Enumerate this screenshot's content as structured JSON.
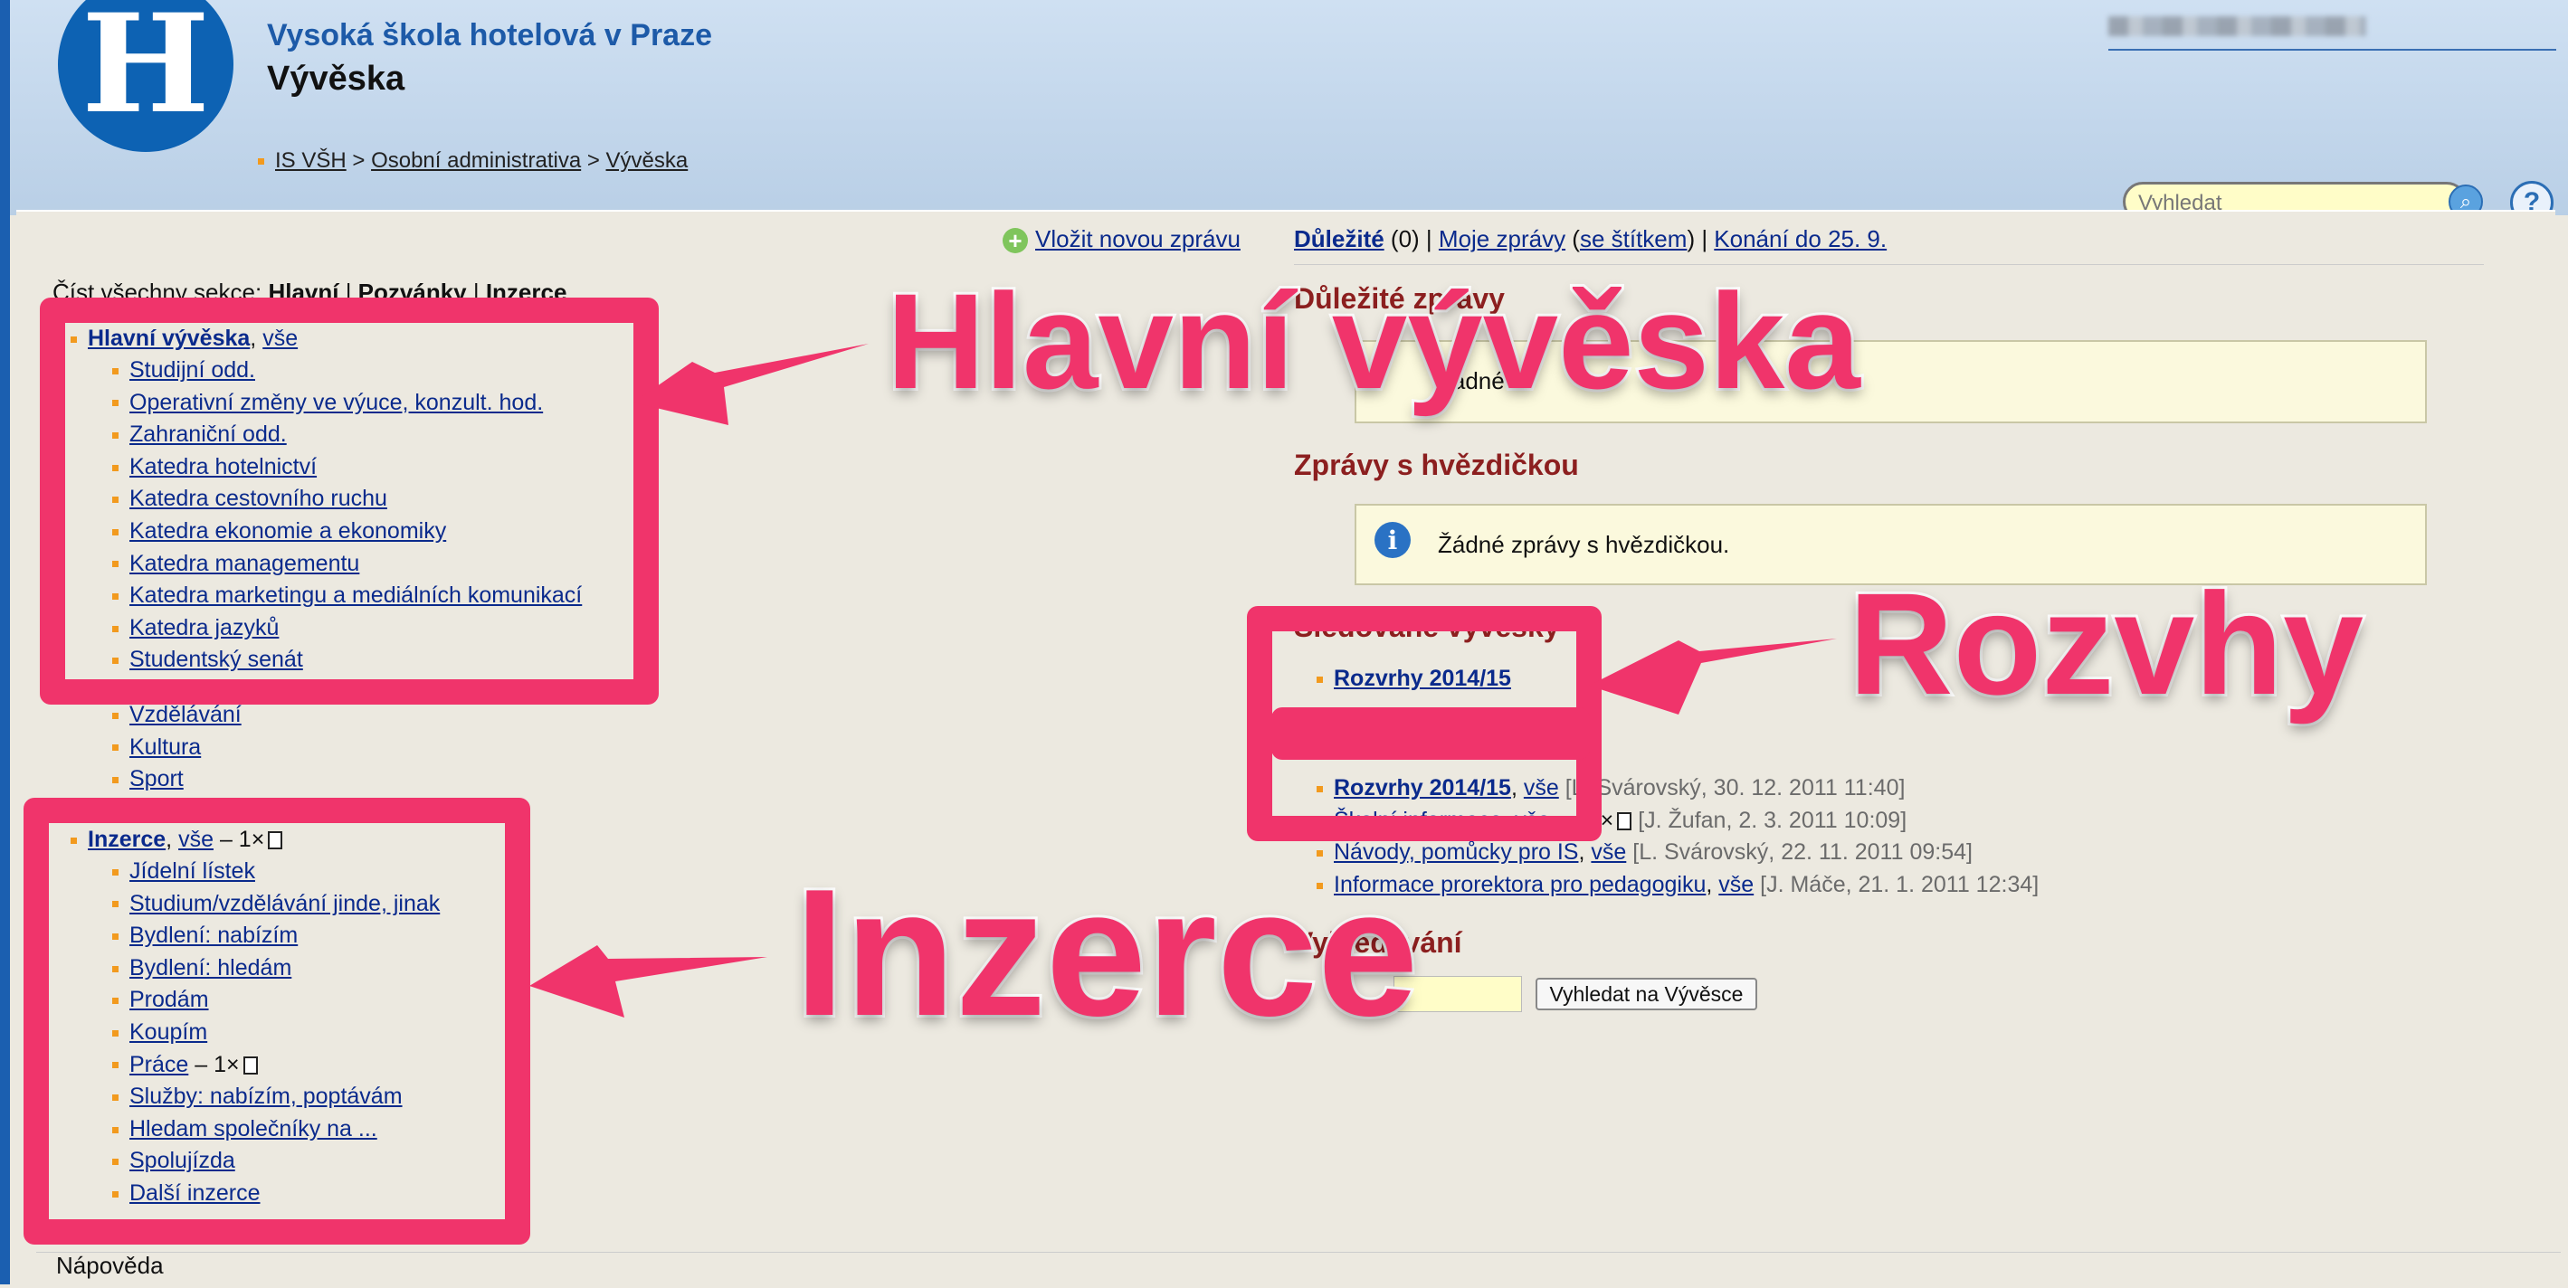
{
  "header": {
    "school": "Vysoká škola hotelová v Praze",
    "title": "Vývěska",
    "logo_letter": "H",
    "breadcrumb": [
      "IS VŠH",
      "Osobní administrativa",
      "Vývěska"
    ],
    "search_placeholder": "Vyhledat",
    "help_label": "?"
  },
  "topbar": {
    "new_message": "Vložit novou zprávu",
    "important": "Důležité",
    "important_count": "(0)",
    "my_messages": "Moje zprávy",
    "with_label": "se štítkem",
    "events": "Konání do 25. 9."
  },
  "left": {
    "read_all_prefix": "Číst všechny sekce:",
    "read_all_links": [
      "Hlavní",
      "Pozvánky",
      "Inzerce"
    ],
    "main_board": {
      "title": "Hlavní vývěska",
      "all": "vše",
      "items": [
        "Studijní odd.",
        "Operativní změny ve výuce, konzult. hod.",
        "Zahraniční odd.",
        "Katedra hotelnictví",
        "Katedra cestovního ruchu",
        "Katedra ekonomie a ekonomiky",
        "Katedra managementu",
        "Katedra marketingu a mediálních komunikací",
        "Katedra jazyků",
        "Studentský senát"
      ]
    },
    "invitations": {
      "items": [
        "Vzdělávání",
        "Kultura",
        "Sport"
      ]
    },
    "ads": {
      "title": "Inzerce",
      "all": "vše",
      "count": "– 1×",
      "items": [
        "Jídelní lístek",
        "Studium/vzdělávání jinde, jinak",
        "Bydlení: nabízím",
        "Bydlení: hledám",
        "Prodám",
        "Koupím",
        "Práce",
        "Služby: nabízím, poptávám",
        "Hledam společníky na ...",
        "Spolujízda",
        "Další inzerce"
      ],
      "prace_count": "– 1×"
    }
  },
  "right": {
    "important_title": "Důležité zprávy",
    "important_box": "Žádné",
    "starred_title": "Zprávy s hvězdičkou",
    "starred_box": "Žádné zprávy s hvězdičkou.",
    "watched_title": "Sledované vývěsky",
    "watched_item": "Rozvrhy 2014/15",
    "recent": [
      {
        "title": "Rozvrhy 2014/15",
        "all": "vše",
        "meta": "[L. Svárovský, 30. 12. 2011 11:40]"
      },
      {
        "title": "Školní informace",
        "all": "vše",
        "count": "– 13×",
        "meta": "[J. Žufan, 2. 3. 2011 10:09]"
      },
      {
        "title": "Návody, pomůcky pro IS",
        "all": "vše",
        "meta": "[L. Svárovský, 22. 11. 2011 09:54]"
      },
      {
        "title": "Informace prorektora pro pedagogiku",
        "all": "vše",
        "meta": "[J. Máče, 21. 1. 2011 12:34]"
      }
    ],
    "search_title": "Vyhledávání",
    "search_button": "Vyhledat na Vývěsce"
  },
  "footer": {
    "text": "Nápověda"
  },
  "annotations": {
    "main_label": "Hlavní vývěska",
    "timetable_label": "Rozvhy",
    "ads_label": "Inzerce",
    "color": "#f0346b"
  }
}
